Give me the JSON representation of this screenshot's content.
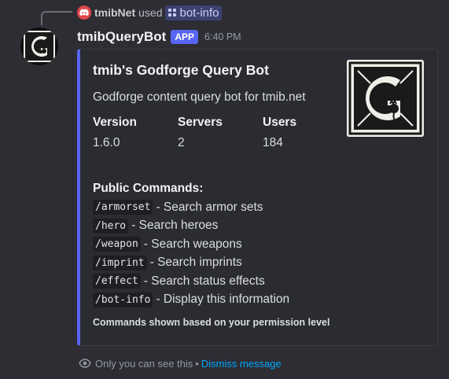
{
  "reply": {
    "username": "tmibNet",
    "used_text": "used",
    "command": "bot-info"
  },
  "message": {
    "bot_name": "tmibQueryBot",
    "badge": "APP",
    "time": "6:40 PM"
  },
  "embed": {
    "accent_color": "#5865f2",
    "title": "tmib's Godforge Query Bot",
    "description": "Godforge content query bot for tmib.net",
    "fields": [
      {
        "name": "Version",
        "value": "1.6.0"
      },
      {
        "name": "Servers",
        "value": "2"
      },
      {
        "name": "Users",
        "value": "184"
      }
    ],
    "commands_title": "Public Commands:",
    "commands": [
      {
        "code": "/armorset",
        "desc": "- Search armor sets"
      },
      {
        "code": "/hero",
        "desc": "- Search heroes"
      },
      {
        "code": "/weapon",
        "desc": "- Search weapons"
      },
      {
        "code": "/imprint",
        "desc": "- Search imprints"
      },
      {
        "code": "/effect",
        "desc": "- Search status effects"
      },
      {
        "code": "/bot-info",
        "desc": "- Display this information"
      }
    ],
    "footer_note": "Commands shown based on your permission level"
  },
  "ephemeral": {
    "icon": "eye-icon",
    "text": "Only you can see this",
    "separator": "•",
    "dismiss": "Dismiss message"
  }
}
